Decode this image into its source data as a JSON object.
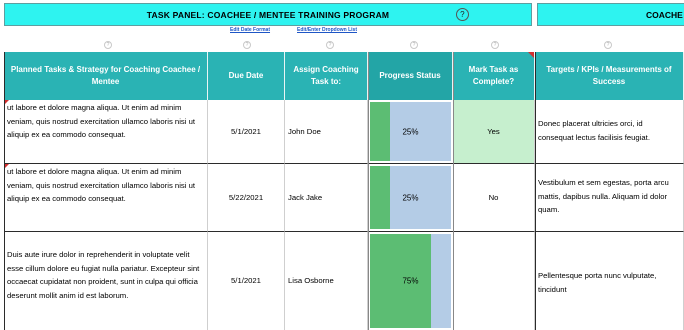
{
  "title": {
    "main": "TASK PANEL: COACHEE / MENTEE  TRAINING PROGRAM",
    "help_symbol": "?",
    "right": "COACHE"
  },
  "links": {
    "edit_date_format": "Edit Date Format",
    "edit_dropdown_list": "Edit/Enter Dropdown List"
  },
  "tiny_help_symbol": "?",
  "headers": {
    "tasks": "Planned Tasks & Strategy for Coaching Coachee / Mentee",
    "due_date": "Due Date",
    "assign": "Assign Coaching Task to:",
    "progress": "Progress Status",
    "complete": "Mark Task as Complete?",
    "targets": "Targets / KPIs / Measurements of Success"
  },
  "rows": [
    {
      "task": "ut labore et dolore magna aliqua. Ut enim ad minim veniam, quis nostrud exercitation ullamco laboris nisi ut aliquip ex ea commodo consequat.",
      "due_date": "5/1/2021",
      "assignee": "John Doe",
      "progress_label": "25%",
      "progress_value": 0.25,
      "complete": "Yes",
      "target": "Donec placerat ultricies orci, id consequat lectus facilisis feugiat."
    },
    {
      "task": "ut labore et dolore magna aliqua. Ut enim ad minim veniam, quis nostrud exercitation ullamco laboris nisi ut aliquip ex ea commodo consequat.",
      "due_date": "5/22/2021",
      "assignee": "Jack Jake",
      "progress_label": "25%",
      "progress_value": 0.25,
      "complete": "No",
      "target": "Vestibulum et sem egestas, porta arcu mattis, dapibus nulla. Aliquam id dolor quam."
    },
    {
      "task": "Duis aute irure dolor in reprehenderit in voluptate velit esse cillum dolore eu fugiat nulla pariatur. Excepteur sint occaecat cupidatat non proident, sunt in culpa qui officia deserunt mollit anim id est laborum.",
      "due_date": "5/1/2021",
      "assignee": "Lisa Osborne",
      "progress_label": "75%",
      "progress_value": 0.75,
      "complete": "",
      "target": "Pellentesque porta nunc vulputate, tincidunt"
    }
  ],
  "colors": {
    "title_bg": "#2ef3f0",
    "header_bg": "#2ab3b4",
    "progress_fill": "#5cbd73",
    "progress_track": "#b4cce6",
    "complete_yes_bg": "#c6efce",
    "link": "#1e56c6"
  }
}
